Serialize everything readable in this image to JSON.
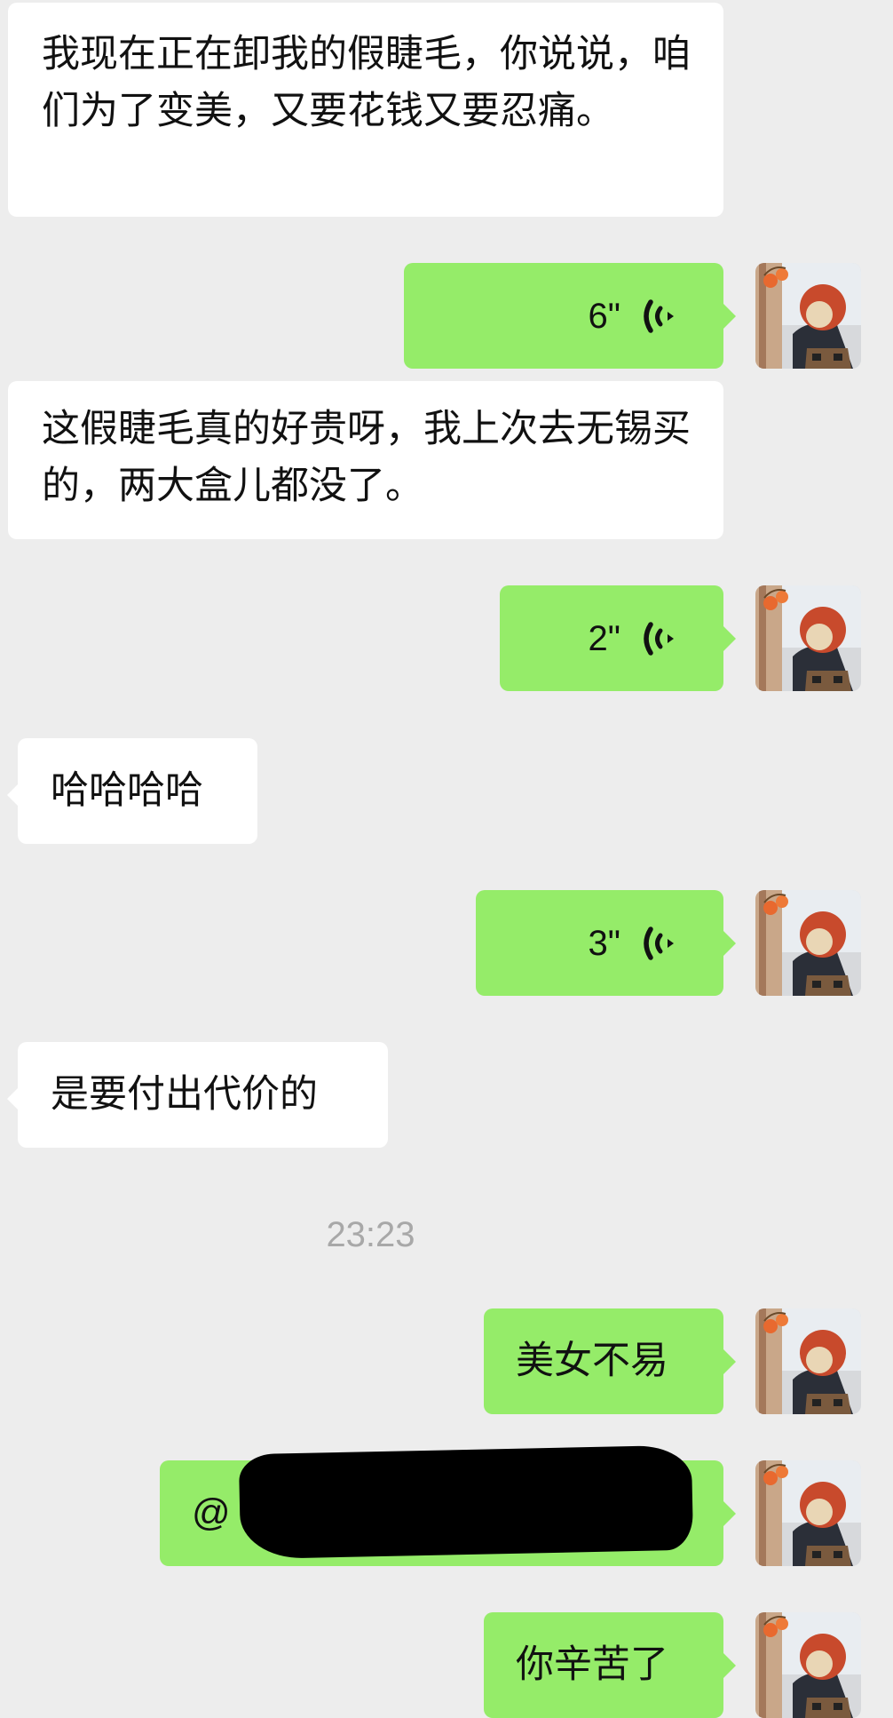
{
  "chat": {
    "messages": [
      {
        "side": "in",
        "type": "text",
        "text": "我现在正在卸我的假睫毛，你说说，咱们为了变美，又要花钱又要忍痛。"
      },
      {
        "side": "out",
        "type": "voice",
        "duration": "6\""
      },
      {
        "side": "in",
        "type": "text",
        "text": "这假睫毛真的好贵呀，我上次去无锡买的，两大盒儿都没了。"
      },
      {
        "side": "out",
        "type": "voice",
        "duration": "2\""
      },
      {
        "side": "in",
        "type": "text",
        "text": "哈哈哈哈"
      },
      {
        "side": "out",
        "type": "voice",
        "duration": "3\""
      },
      {
        "side": "in",
        "type": "text",
        "text": "是要付出代价的"
      },
      {
        "side": "out",
        "type": "text",
        "text": "美女不易"
      },
      {
        "side": "out",
        "type": "text",
        "text": "@"
      },
      {
        "side": "out",
        "type": "text",
        "text": "你辛苦了"
      }
    ],
    "timestamp": "23:23"
  },
  "icons": {
    "voice": "voice-wave-icon",
    "avatar": "user-avatar"
  },
  "colors": {
    "background": "#ededed",
    "incoming_bubble": "#ffffff",
    "outgoing_bubble": "#95ec69",
    "timestamp_text": "#a8a8a8"
  }
}
